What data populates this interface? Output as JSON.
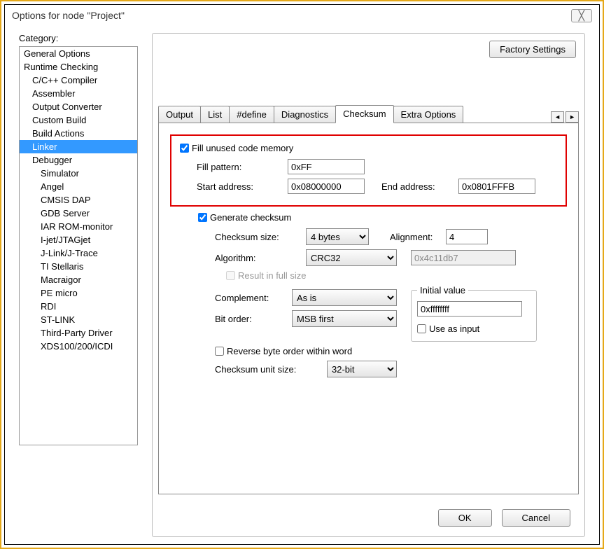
{
  "window": {
    "title": "Options for node \"Project\"",
    "close": "✕"
  },
  "sidebar": {
    "label": "Category:",
    "items": [
      {
        "label": "General Options",
        "indent": 0
      },
      {
        "label": "Runtime Checking",
        "indent": 0
      },
      {
        "label": "C/C++ Compiler",
        "indent": 1
      },
      {
        "label": "Assembler",
        "indent": 1
      },
      {
        "label": "Output Converter",
        "indent": 1
      },
      {
        "label": "Custom Build",
        "indent": 1
      },
      {
        "label": "Build Actions",
        "indent": 1
      },
      {
        "label": "Linker",
        "indent": 1,
        "selected": true
      },
      {
        "label": "Debugger",
        "indent": 1
      },
      {
        "label": "Simulator",
        "indent": 2
      },
      {
        "label": "Angel",
        "indent": 2
      },
      {
        "label": "CMSIS DAP",
        "indent": 2
      },
      {
        "label": "GDB Server",
        "indent": 2
      },
      {
        "label": "IAR ROM-monitor",
        "indent": 2
      },
      {
        "label": "I-jet/JTAGjet",
        "indent": 2
      },
      {
        "label": "J-Link/J-Trace",
        "indent": 2
      },
      {
        "label": "TI Stellaris",
        "indent": 2
      },
      {
        "label": "Macraigor",
        "indent": 2
      },
      {
        "label": "PE micro",
        "indent": 2
      },
      {
        "label": "RDI",
        "indent": 2
      },
      {
        "label": "ST-LINK",
        "indent": 2
      },
      {
        "label": "Third-Party Driver",
        "indent": 2
      },
      {
        "label": "XDS100/200/ICDI",
        "indent": 2
      }
    ]
  },
  "panel": {
    "factory_btn": "Factory Settings",
    "tabs": [
      "Output",
      "List",
      "#define",
      "Diagnostics",
      "Checksum",
      "Extra Options"
    ],
    "active_tab": "Checksum"
  },
  "checksum": {
    "fill_label": "Fill unused code memory",
    "fill_checked": true,
    "fill_pattern_label": "Fill pattern:",
    "fill_pattern": "0xFF",
    "start_label": "Start address:",
    "start": "0x08000000",
    "end_label": "End address:",
    "end": "0x0801FFFB",
    "gen_label": "Generate checksum",
    "gen_checked": true,
    "size_label": "Checksum size:",
    "size": "4 bytes",
    "align_label": "Alignment:",
    "align": "4",
    "algo_label": "Algorithm:",
    "algo": "CRC32",
    "poly": "0x4c11db7",
    "fullsize_label": "Result in full size",
    "fullsize_checked": false,
    "comp_label": "Complement:",
    "comp": "As is",
    "bitorder_label": "Bit order:",
    "bitorder": "MSB first",
    "iv_legend": "Initial value",
    "iv": "0xffffffff",
    "useinput_label": "Use as input",
    "useinput_checked": false,
    "revbyte_label": "Reverse byte order within word",
    "revbyte_checked": false,
    "unitsize_label": "Checksum unit size:",
    "unitsize": "32-bit"
  },
  "buttons": {
    "ok": "OK",
    "cancel": "Cancel"
  }
}
